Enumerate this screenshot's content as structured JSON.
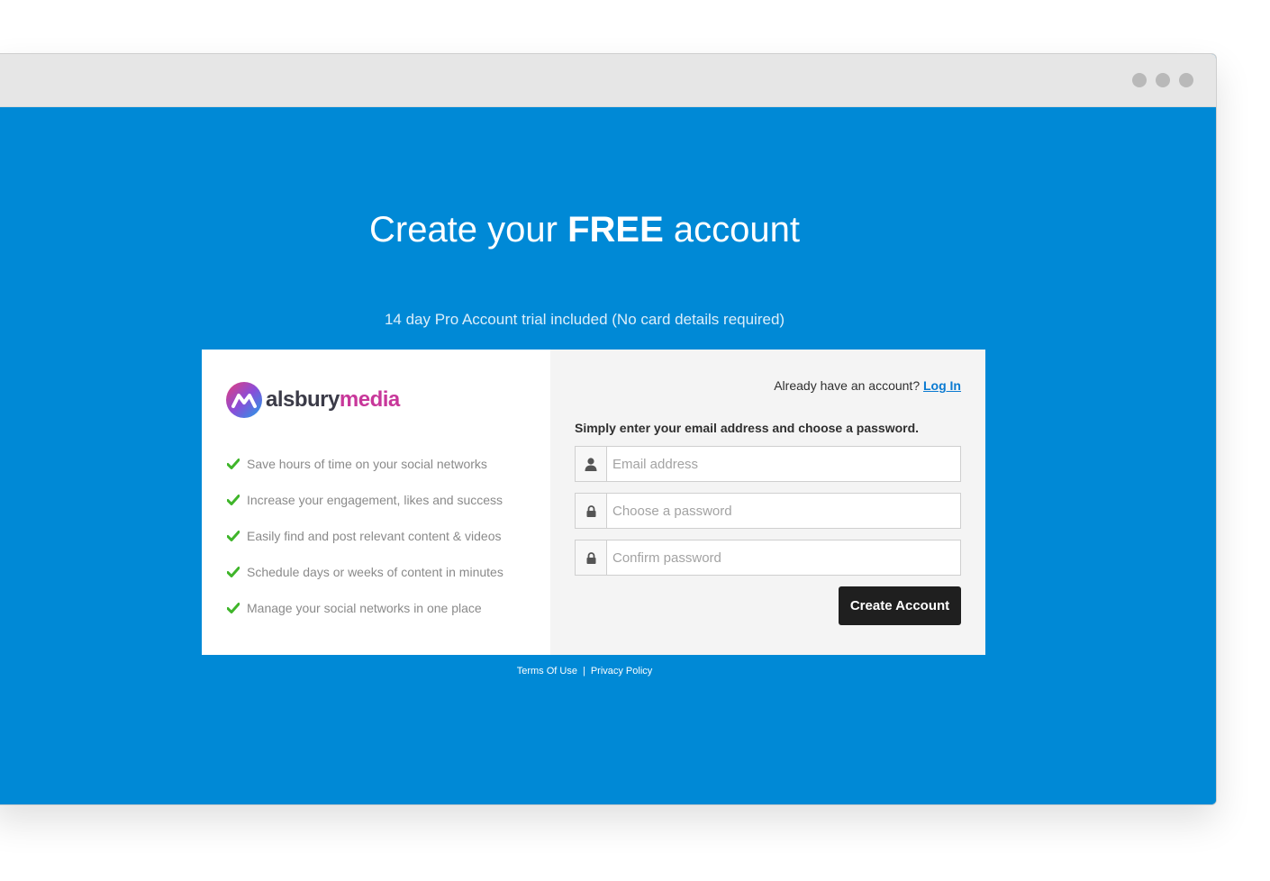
{
  "heading": {
    "prefix": "Create your",
    "emphasis": "FREE",
    "suffix": "account",
    "subtitle": "14 day Pro Account trial included (No card details required)"
  },
  "brand": {
    "name_part1": "alsbury",
    "name_part2": "media",
    "colors": {
      "pink": "#e53d7a",
      "purple": "#8a4dd8",
      "blue": "#1ea0e8",
      "dark": "#3b3b48"
    }
  },
  "features": [
    {
      "icon": "check-icon",
      "text": "Save hours of time on your social networks"
    },
    {
      "icon": "check-icon",
      "text": "Increase your engagement, likes and success"
    },
    {
      "icon": "check-icon",
      "text": "Easily find and post relevant content & videos"
    },
    {
      "icon": "check-icon",
      "text": "Schedule days or weeks of content in minutes"
    },
    {
      "icon": "check-icon",
      "text": "Manage your social networks in one place"
    }
  ],
  "login": {
    "prompt": "Already have an account?",
    "link_label": "Log In"
  },
  "form": {
    "instructions": "Simply enter your email address and choose a password.",
    "email": {
      "placeholder": "Email address",
      "value": "",
      "icon": "user-icon"
    },
    "password": {
      "placeholder": "Choose a password",
      "value": "",
      "icon": "lock-icon"
    },
    "confirm": {
      "placeholder": "Confirm password",
      "value": "",
      "icon": "lock-icon"
    },
    "submit_label": "Create Account"
  },
  "footer": {
    "terms": "Terms Of Use",
    "separator": "|",
    "privacy": "Privacy Policy"
  },
  "theme": {
    "background": "#0089d6",
    "check_color": "#3fb52a",
    "button": "#1f1f1f",
    "link": "#0a7ad1"
  }
}
